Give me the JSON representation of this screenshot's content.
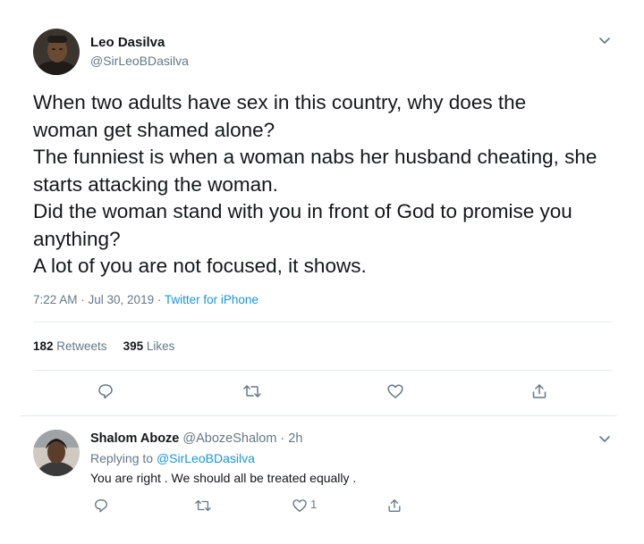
{
  "tweet": {
    "author_name": "Leo Dasilva",
    "author_handle": "@SirLeoBDasilva",
    "text_lines": [
      "When two adults have sex in this country, why does the",
      "woman get shamed alone?",
      "The funniest is when a woman nabs her husband cheating, she",
      "starts attacking the woman.",
      "Did the woman stand with you in front of God to promise you",
      "anything?",
      "A lot of you are not focused, it shows."
    ],
    "timestamp": "7:22 AM · Jul 30, 2019 · ",
    "source": "Twitter for iPhone",
    "retweet_count": "182",
    "retweet_label": " Retweets",
    "like_count": "395",
    "like_label": " Likes",
    "icons": [
      "reply-icon",
      "retweet-icon",
      "like-icon",
      "share-icon",
      "chevron-down-icon"
    ]
  },
  "reply": {
    "author_name": "Shalom Aboze",
    "author_handle": " @AbozeShalom · 2h",
    "replying_prefix": "Replying to ",
    "replying_to": "@SirLeoBDasilva",
    "text": "You are right .  We should all be treated equally .",
    "like_count": "1"
  },
  "colors": {
    "text": "#14171a",
    "secondary": "#657786",
    "link": "#1b95e0",
    "divider": "#e6ecf0"
  }
}
